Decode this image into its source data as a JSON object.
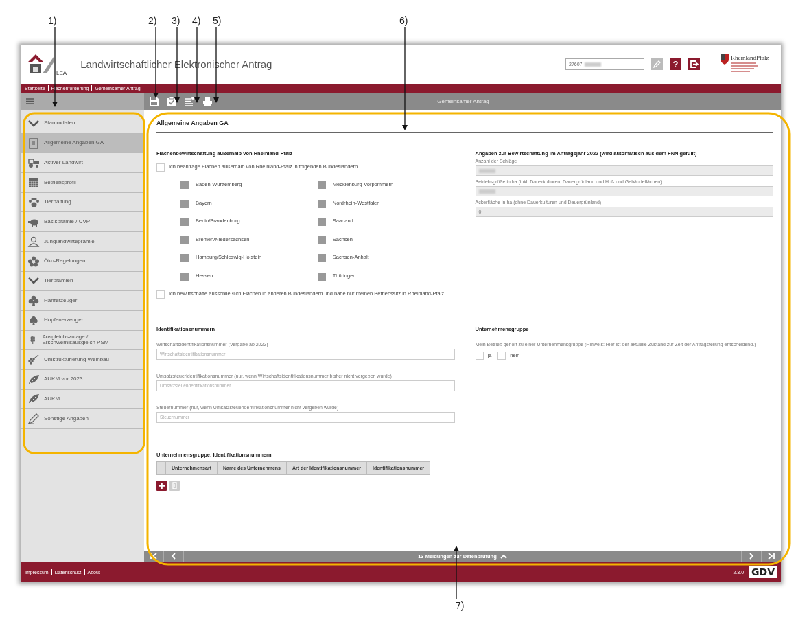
{
  "annotations": {
    "labels": [
      "1)",
      "2)",
      "3)",
      "4)",
      "5)",
      "6)",
      "7)"
    ]
  },
  "header": {
    "logo_text": "LEA",
    "title": "Landwirtschaftlicher Elektronischer Antrag",
    "customer_field": {
      "value": "27607",
      "redacted": true
    },
    "help_label": "?",
    "state_logo_text": "RheinlandPfalz"
  },
  "breadcrumb": [
    {
      "label": "Startseite",
      "link": true
    },
    {
      "label": "Flächenförderung",
      "link": false
    },
    {
      "label": "Gemeinsamer Antrag",
      "link": false
    }
  ],
  "toolbar": {
    "title": "Gemeinsamer Antrag"
  },
  "sidebar": {
    "items": [
      {
        "label": "Stammdaten",
        "kind": "group",
        "selected": false
      },
      {
        "label": "Allgemeine Angaben GA",
        "kind": "page",
        "selected": true
      },
      {
        "label": "Aktiver Landwirt",
        "kind": "page",
        "selected": false
      },
      {
        "label": "Betriebsprofil",
        "kind": "page",
        "selected": false
      },
      {
        "label": "Tierhaltung",
        "kind": "page",
        "selected": false
      },
      {
        "label": "Basisprämie / UVP",
        "kind": "page",
        "selected": false
      },
      {
        "label": "Junglandwirteprämie",
        "kind": "page",
        "selected": false
      },
      {
        "label": "Öko-Regelungen",
        "kind": "page",
        "selected": false
      },
      {
        "label": "Tierprämien",
        "kind": "group",
        "selected": false
      },
      {
        "label": "Hanferzeuger",
        "kind": "page",
        "selected": false
      },
      {
        "label": "Hopfenerzeuger",
        "kind": "page",
        "selected": false
      },
      {
        "label": "Ausgleichszulage / Erschwernisausgleich PSM",
        "kind": "page",
        "selected": false
      },
      {
        "label": "Umstrukturierung Weinbau",
        "kind": "page",
        "selected": false
      },
      {
        "label": "AUKM vor 2023",
        "kind": "page",
        "selected": false
      },
      {
        "label": "AUKM",
        "kind": "page",
        "selected": false
      },
      {
        "label": "Sonstige Angaben",
        "kind": "page",
        "selected": false
      }
    ]
  },
  "page_title": "Allgemeine Angaben GA",
  "outside_section": {
    "heading": "Flächenbewirtschaftung außerhalb von Rheinland-Pfalz",
    "apply_checkbox": {
      "label": "Ich beantrage Flächen außerhalb von Rheinland-Pfalz in folgenden Bundesländern",
      "checked": false
    },
    "states": [
      {
        "label": "Baden-Württemberg",
        "checked": false,
        "disabled": true
      },
      {
        "label": "Mecklenburg-Vorpommern",
        "checked": false,
        "disabled": true
      },
      {
        "label": "Bayern",
        "checked": false,
        "disabled": true
      },
      {
        "label": "Nordrhein-Westfalen",
        "checked": false,
        "disabled": true
      },
      {
        "label": "Berlin/Brandenburg",
        "checked": false,
        "disabled": true
      },
      {
        "label": "Saarland",
        "checked": false,
        "disabled": true
      },
      {
        "label": "Bremen/Niedersachsen",
        "checked": false,
        "disabled": true
      },
      {
        "label": "Sachsen",
        "checked": false,
        "disabled": true
      },
      {
        "label": "Hamburg/Schleswig-Holstein",
        "checked": false,
        "disabled": true
      },
      {
        "label": "Sachsen-Anhalt",
        "checked": false,
        "disabled": true
      },
      {
        "label": "Hessen",
        "checked": false,
        "disabled": true
      },
      {
        "label": "Thüringen",
        "checked": false,
        "disabled": true
      }
    ],
    "exclusive_checkbox": {
      "label": "Ich bewirtschafte ausschließlich Flächen in anderen Bundesländern und habe nur meinen Betriebssitz in Rheinland-Pfalz.",
      "checked": false
    }
  },
  "management_section": {
    "heading": "Angaben zur Bewirtschaftung im Antragsjahr 2022 (wird automatisch aus dem FNN gefüllt)",
    "fields": [
      {
        "label": "Anzahl der Schläge",
        "redacted": true
      },
      {
        "label": "Betriebsgröße in ha (inkl. Dauerkulturen, Dauergrünland und Hof- und Gebäudeflächen)",
        "redacted": true
      },
      {
        "label": "Ackerfläche in ha (ohne Dauerkulturen und Dauergrünland)",
        "value": "0",
        "redacted": false
      }
    ]
  },
  "id_section": {
    "heading": "Identifikationsnummern",
    "fields": [
      {
        "label": "Wirtschaftsidentifikationsnummer (Vergabe ab 2023)",
        "placeholder": "Wirtschaftsidentifikationsnummer"
      },
      {
        "label": "Umsatzsteueridentifikationsnummer (nur, wenn Wirtschaftsidentifikationsnummer bisher nicht vergeben wurde)",
        "placeholder": "Umsatzsteueridentifikationsnummer"
      },
      {
        "label": "Steuernummer (nur, wenn Umsatzsteueridentifikationsnummer nicht vergeben wurde)",
        "placeholder": "Steuernummer"
      }
    ]
  },
  "group_section": {
    "heading": "Unternehmensgruppe",
    "text": "Mein Betrieb gehört zu einer Unternehmensgruppe (Hinweis: Hier ist der aktuelle Zustand zur Zeit der Antragstellung entscheidend.)",
    "options": [
      {
        "label": "ja",
        "checked": false
      },
      {
        "label": "nein",
        "checked": false
      }
    ]
  },
  "group_table": {
    "title": "Unternehmensgruppe: Identifikationsnummern",
    "columns": [
      "Unternehmensart",
      "Name des Unternehmens",
      "Art der Identifikationsnummer",
      "Identifikationsnummer"
    ],
    "edit_disabled": true
  },
  "nav_bar": {
    "message": "13 Meldungen zur Datenprüfung"
  },
  "footer": {
    "links": [
      "Impressum",
      "Datenschutz",
      "About"
    ],
    "version": "2.3.0",
    "logo_text": "GDV"
  }
}
